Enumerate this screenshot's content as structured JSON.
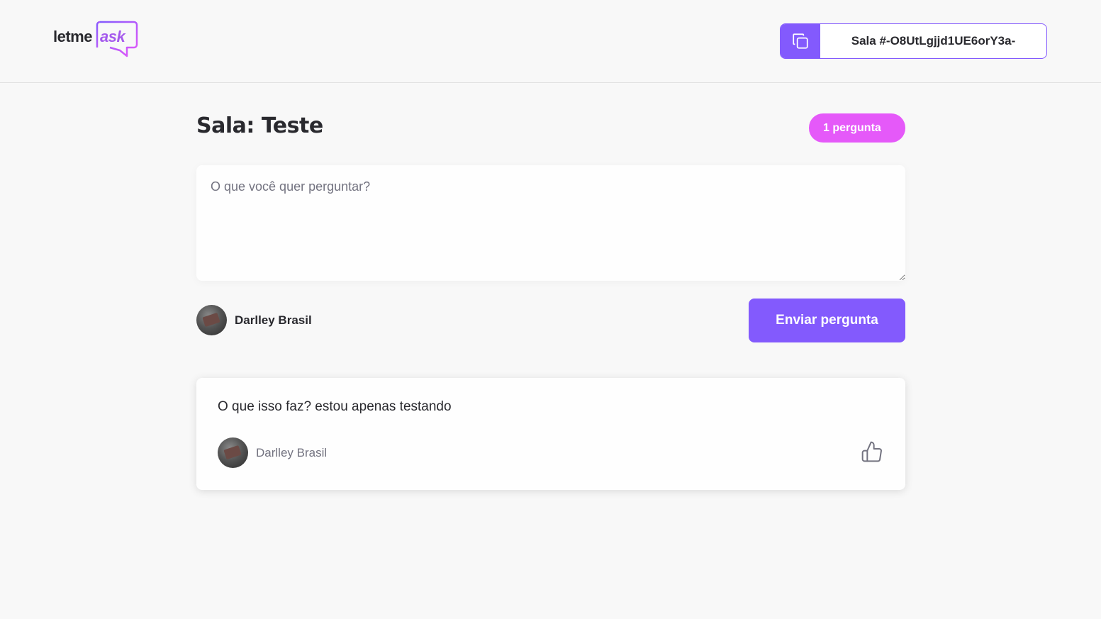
{
  "header": {
    "logo": {
      "part1": "letme",
      "part2": "ask"
    },
    "room_code": {
      "text": "Sala #-O8UtLgjjd1UE6orY3a-",
      "copy_icon": "copy-icon"
    }
  },
  "room": {
    "title": "Sala: Teste",
    "question_count": "1 pergunta"
  },
  "form": {
    "placeholder": "O que você quer perguntar?",
    "value": "",
    "user_name": "Darlley Brasil",
    "send_label": "Enviar pergunta"
  },
  "questions": [
    {
      "content": "O que isso faz? estou apenas testando",
      "author": "Darlley Brasil",
      "like_icon": "thumbs-up-icon"
    }
  ],
  "colors": {
    "primary": "#835afd",
    "accent": "#e559f9",
    "background": "#f8f8f8",
    "text": "#29292e",
    "muted": "#737380"
  }
}
